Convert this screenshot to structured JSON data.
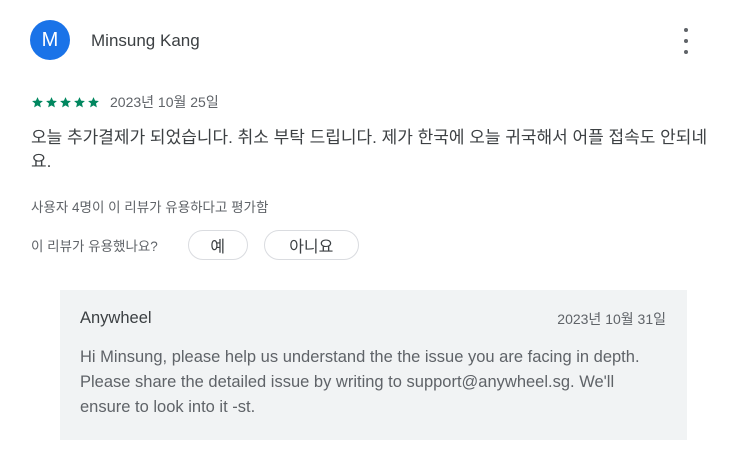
{
  "review": {
    "avatar_letter": "M",
    "author_name": "Minsung Kang",
    "rating": 5,
    "date": "2023년 10월 25일",
    "text": "오늘 추가결제가 되었습니다. 취소 부탁 드립니다. 제가 한국에 오늘 귀국해서 어플 접속도 안되네요.",
    "helpful_count_text": "사용자 4명이 이 리뷰가 유용하다고 평가함",
    "helpful_question": "이 리뷰가 유용했나요?",
    "yes_label": "예",
    "no_label": "아니요"
  },
  "reply": {
    "author": "Anywheel",
    "date": "2023년 10월 31일",
    "text": "Hi Minsung, please help us understand the the issue you are facing in depth. Please share the detailed issue by writing to support@anywheel.sg. We'll ensure to look into it -st."
  },
  "colors": {
    "avatar": "#1a73e8",
    "star": "#01875f",
    "reply_background": "#f1f3f4"
  },
  "icons": {
    "more": "more-vert-icon",
    "star": "star-icon"
  }
}
